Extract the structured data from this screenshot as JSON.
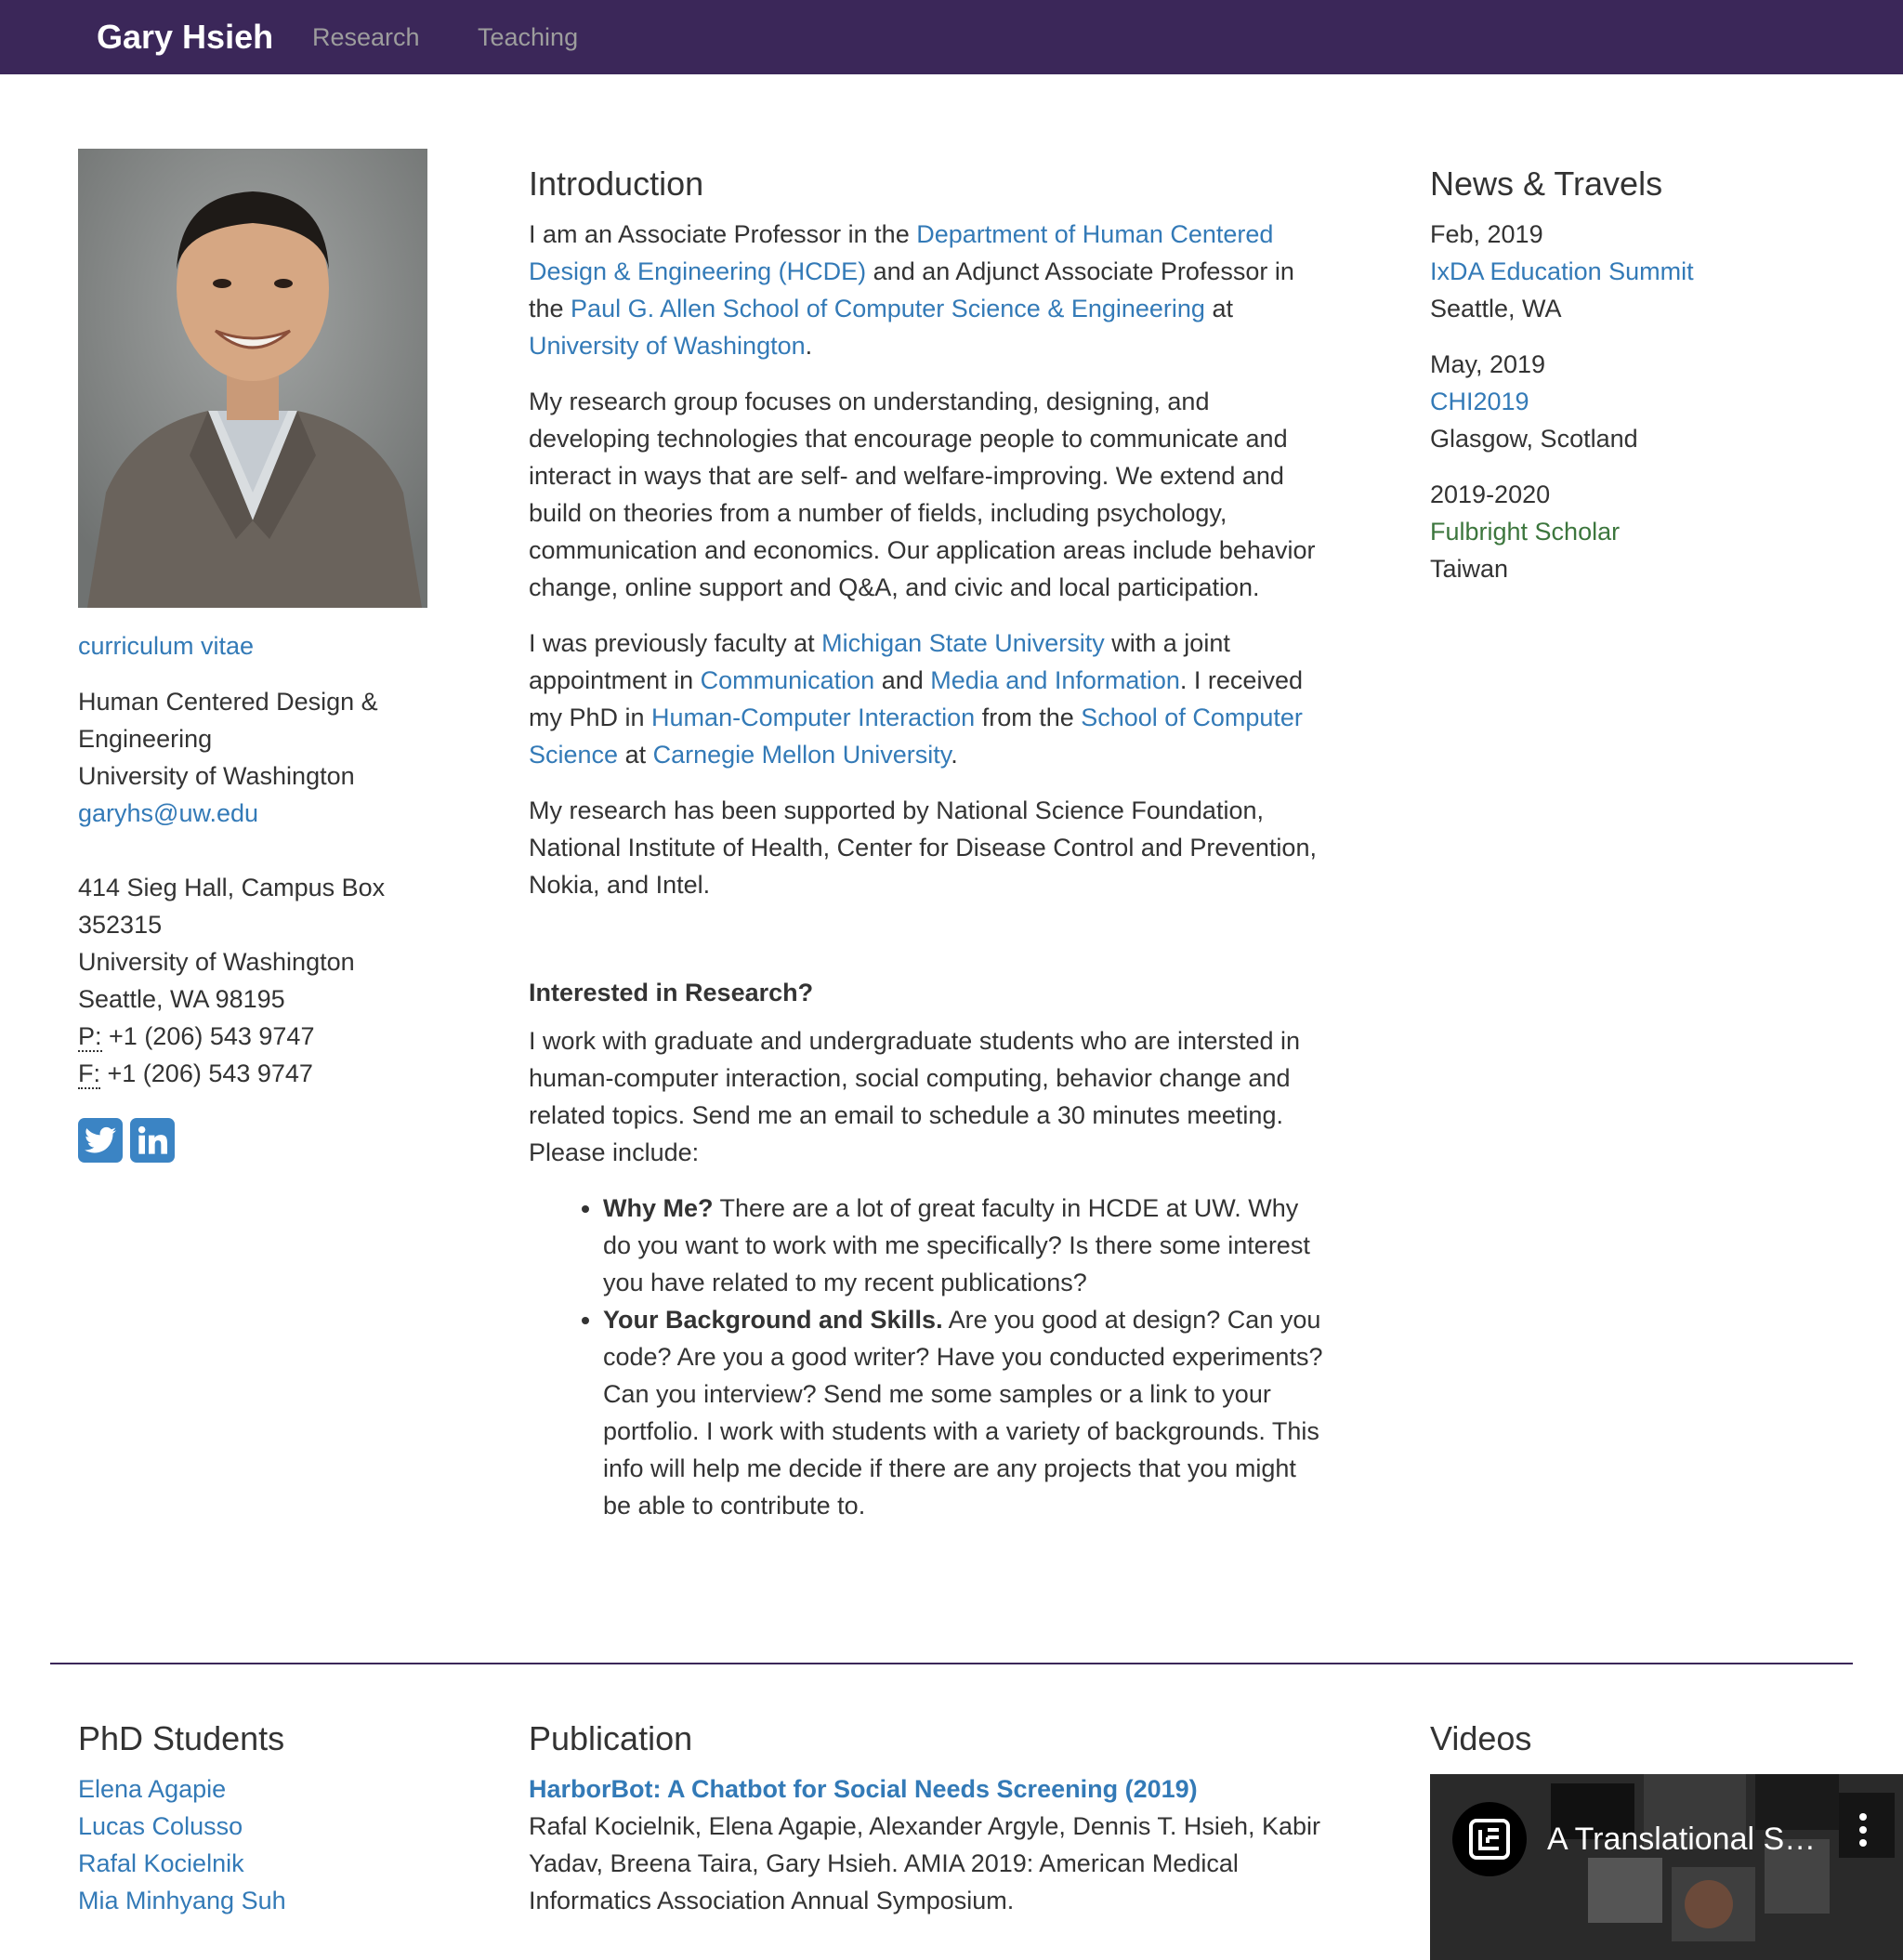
{
  "nav": {
    "brand": "Gary Hsieh",
    "links": [
      "Research",
      "Teaching"
    ]
  },
  "profile": {
    "cv_link": "curriculum vitae",
    "dept_line1": "Human Centered Design &",
    "dept_line2": "Engineering",
    "university": "University of Washington",
    "email": "garyhs@uw.edu",
    "addr_line1": "414 Sieg Hall, Campus Box",
    "addr_line2": "352315",
    "addr_line3": "University of Washington",
    "addr_line4": "Seattle, WA 98195",
    "phone_label": "P:",
    "phone": "+1 (206) 543 9747",
    "fax_label": "F:",
    "fax": "+1 (206) 543 9747",
    "social": [
      "twitter-icon",
      "linkedin-icon"
    ]
  },
  "intro": {
    "heading": "Introduction",
    "p1_t1": "I am an Associate Professor in the ",
    "p1_l1": "Department of Human Centered Design & Engineering (HCDE)",
    "p1_t2": " and an Adjunct Associate Professor in the ",
    "p1_l2": "Paul G. Allen School of Computer Science & Engineering",
    "p1_t3": " at ",
    "p1_l3": "University of Washington",
    "p1_t4": ".",
    "p2": "My research group focuses on understanding, designing, and developing technologies that encourage people to communicate and interact in ways that are self- and welfare-improving. We extend and build on theories from a number of fields, including psychology, communication and economics. Our application areas include behavior change, online support and Q&A, and civic and local participation.",
    "p3_t1": "I was previously faculty at ",
    "p3_l1": "Michigan State University",
    "p3_t2": " with a joint appointment in ",
    "p3_l2": "Communication",
    "p3_t3": " and ",
    "p3_l3": "Media and Information",
    "p3_t4": ". I received my PhD in ",
    "p3_l4": "Human-Computer Interaction",
    "p3_t5": " from the ",
    "p3_l5": "School of Computer Science",
    "p3_t6": " at ",
    "p3_l6": "Carnegie Mellon University",
    "p3_t7": ".",
    "p4": "My research has been supported by National Science Foundation, National Institute of Health, Center for Disease Control and Prevention, Nokia, and Intel."
  },
  "research": {
    "heading": "Interested in Research?",
    "p": "I work with graduate and undergraduate students who are intersted in human-computer interaction, social computing, behavior change and related topics. Send me an email to schedule a 30 minutes meeting. Please include:",
    "items": [
      {
        "bold": "Why Me?",
        "text": " There are a lot of great faculty in HCDE at UW. Why do you want to work with me specifically? Is there some interest you have related to my recent publications?"
      },
      {
        "bold": "Your Background and Skills.",
        "text": " Are you good at design? Can you code? Are you a good writer? Have you conducted experiments? Can you interview? Send me some samples or a link to your portfolio. I work with students with a variety of backgrounds. This info will help me decide if there are any projects that you might be able to contribute to."
      }
    ]
  },
  "news": {
    "heading": "News & Travels",
    "items": [
      {
        "date": "Feb, 2019",
        "title": "IxDA Education Summit",
        "place": "Seattle, WA"
      },
      {
        "date": "May, 2019",
        "title": "CHI2019",
        "place": "Glasgow, Scotland"
      },
      {
        "date": "2019-2020",
        "title": "Fulbright Scholar",
        "place": "Taiwan"
      }
    ],
    "highlight_color": "#3c763d"
  },
  "students": {
    "heading": "PhD Students",
    "names": [
      "Elena Agapie",
      "Lucas Colusso",
      "Rafal Kocielnik",
      "Mia Minhyang Suh"
    ]
  },
  "publication": {
    "heading": "Publication",
    "title": "HarborBot: A Chatbot for Social Needs Screening (2019)",
    "body": "Rafal Kocielnik, Elena Agapie, Alexander Argyle, Dennis T. Hsieh, Kabir Yadav, Breena Taira, Gary Hsieh. AMIA 2019: American Medical Informatics Association Annual Symposium."
  },
  "videos": {
    "heading": "Videos",
    "title": "A Translational S…"
  },
  "colors": {
    "navbar": "#3b2759",
    "link": "#337ab7",
    "text": "#333333"
  }
}
